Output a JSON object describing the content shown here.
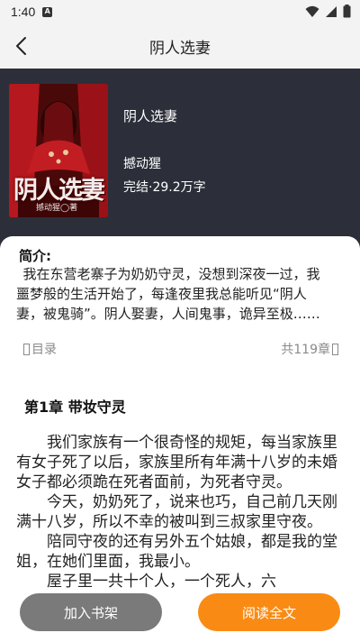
{
  "status_bar": {
    "time": "1:40",
    "notification_glyph": "A"
  },
  "nav": {
    "title": "阴人选妻"
  },
  "book": {
    "title": "阴人选妻",
    "author": "撼动猩",
    "meta": "完结·29.2万字",
    "cover_title": "阴人选妻",
    "cover_author": "撼动猩◯著"
  },
  "intro": {
    "label": "简介:",
    "text": "我在东营老寨子为奶奶守灵，没想到深夜一过，我噩梦般的生活开始了，每逢夜里我总能听见“阴人妻，被鬼骑”。阴人娶妻，人间鬼事，诡异至极……"
  },
  "toc": {
    "left_label": "目录",
    "right_label": "共119章"
  },
  "chapter": {
    "title": "第1章 带妆守灵",
    "paragraphs": [
      "我们家族有一个很奇怪的规矩，每当家族里有女子死了以后，家族里所有年满十八岁的未婚女子都必须跪在死者面前，为死者守灵。",
      "今天，奶奶死了，说来也巧，自己前几天刚满十八岁，所以不幸的被叫到三叔家里守夜。",
      "陪同守夜的还有另外五个姑娘，都是我的堂姐，在她们里面，我最小。",
      "屋子里一共十个人，一个死人，六"
    ]
  },
  "buttons": {
    "add_shelf": "加入书架",
    "read_all": "阅读全文"
  },
  "colors": {
    "accent": "#f98b14",
    "header_bg": "#2c2f39",
    "bar_bg": "#f3f3f3"
  }
}
